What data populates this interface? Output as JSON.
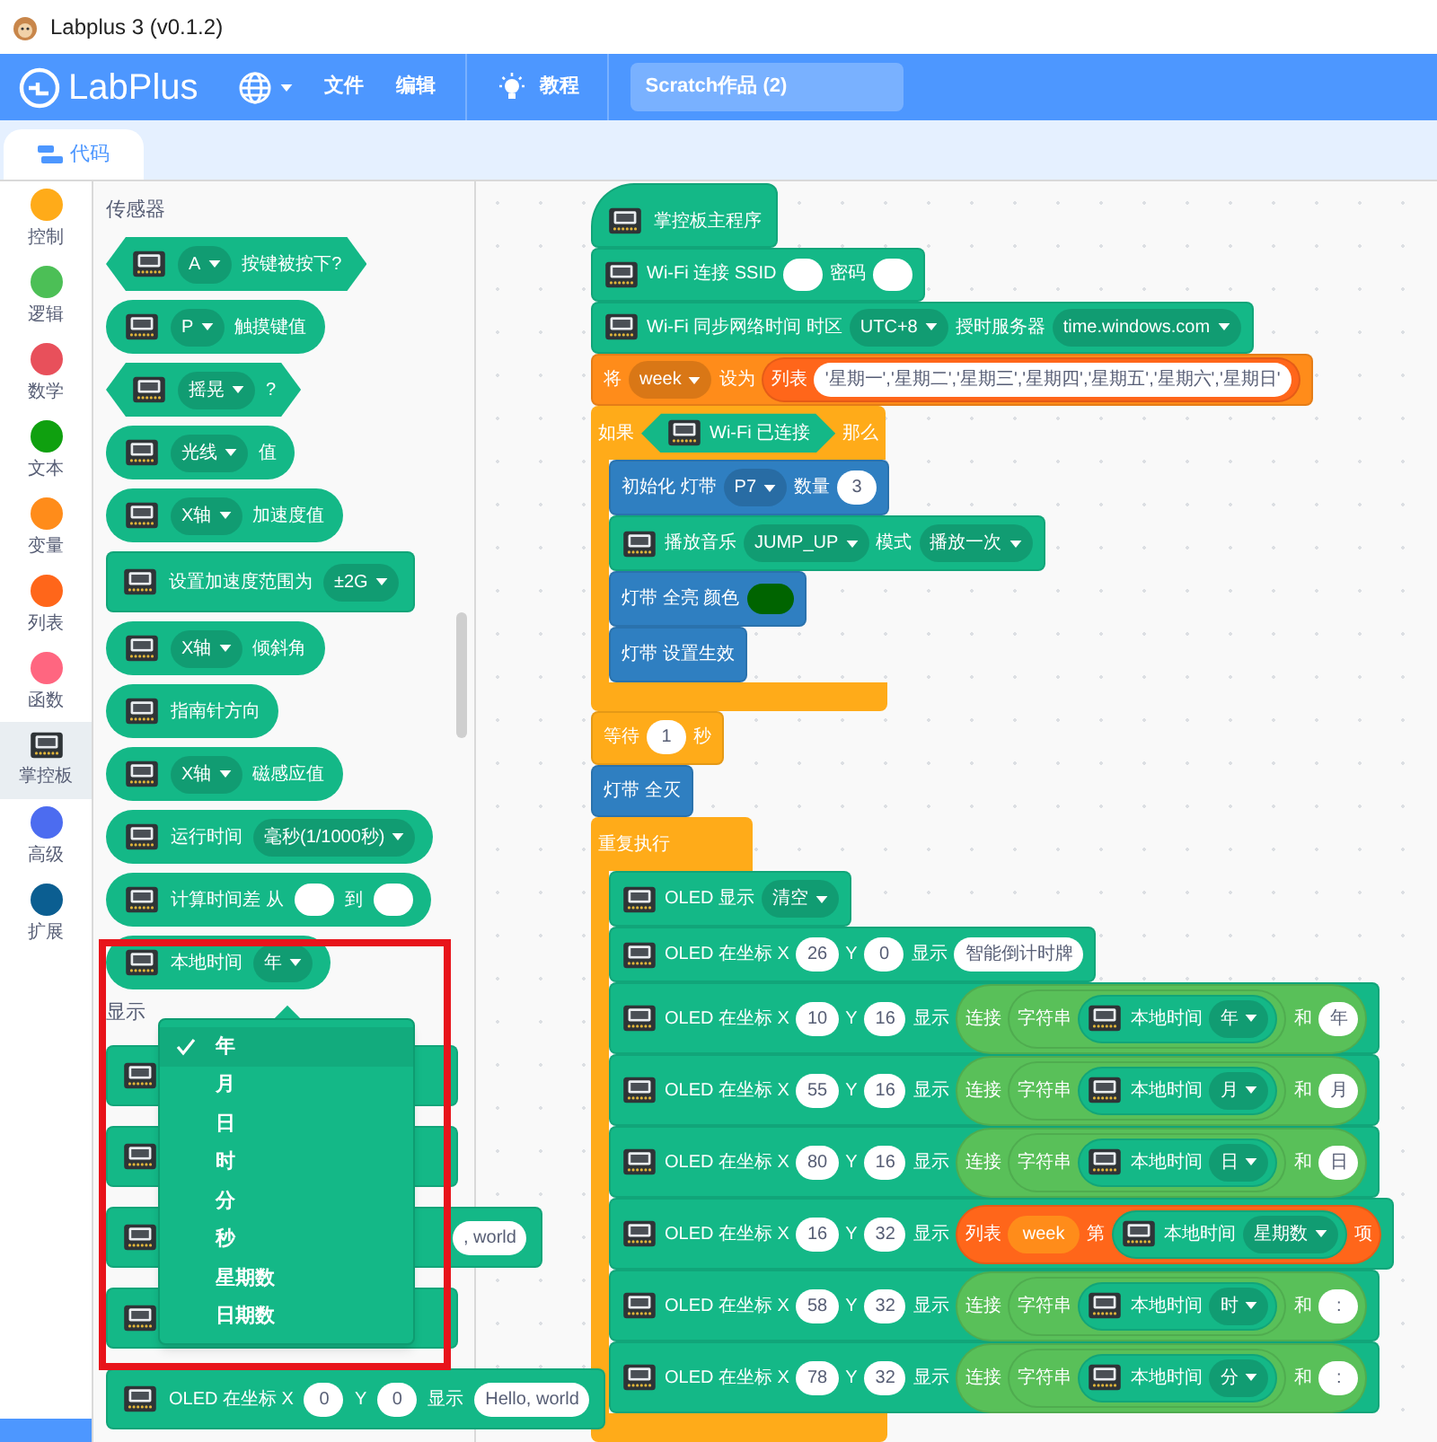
{
  "window": {
    "title": "Labplus 3 (v0.1.2)"
  },
  "header": {
    "logo": "LabPlus",
    "menus": [
      {
        "label": "文件"
      },
      {
        "label": "编辑"
      }
    ],
    "tutorial": "教程",
    "project_title": "Scratch作品 (2)"
  },
  "tabs": [
    {
      "label": "代码",
      "selected": true
    }
  ],
  "categories": [
    {
      "label": "控制",
      "kind": "dot",
      "color": "#ffab19",
      "selected": false
    },
    {
      "label": "逻辑",
      "kind": "dot",
      "color": "#4cbf56",
      "selected": false
    },
    {
      "label": "数学",
      "kind": "dot",
      "color": "#e8505b",
      "selected": false
    },
    {
      "label": "文本",
      "kind": "dot",
      "color": "#0fa00f",
      "selected": false
    },
    {
      "label": "变量",
      "kind": "dot",
      "color": "#ff8c1a",
      "selected": false
    },
    {
      "label": "列表",
      "kind": "dot",
      "color": "#ff661a",
      "selected": false
    },
    {
      "label": "函数",
      "kind": "dot",
      "color": "#ff6680",
      "selected": false
    },
    {
      "label": "掌控板",
      "kind": "board",
      "selected": true
    },
    {
      "label": "高级",
      "kind": "dot",
      "color": "#4c6cf0",
      "selected": false
    },
    {
      "label": "扩展",
      "kind": "dot",
      "color": "#0b5e91",
      "selected": false
    }
  ],
  "palette": [
    {
      "kind": "label",
      "text": "传感器"
    },
    {
      "kind": "hex",
      "color": "#14b887",
      "parts": [
        {
          "kind": "board"
        },
        {
          "kind": "dd",
          "text": "A"
        },
        {
          "kind": "text",
          "text": "按键被按下?"
        }
      ]
    },
    {
      "kind": "round",
      "color": "#14b887",
      "parts": [
        {
          "kind": "board"
        },
        {
          "kind": "dd",
          "text": "P"
        },
        {
          "kind": "text",
          "text": "触摸键值"
        }
      ]
    },
    {
      "kind": "hex",
      "color": "#14b887",
      "parts": [
        {
          "kind": "board"
        },
        {
          "kind": "dd",
          "text": "摇晃"
        },
        {
          "kind": "text",
          "text": "?"
        }
      ]
    },
    {
      "kind": "round",
      "color": "#14b887",
      "parts": [
        {
          "kind": "board"
        },
        {
          "kind": "dd",
          "text": "光线"
        },
        {
          "kind": "text",
          "text": "值"
        }
      ]
    },
    {
      "kind": "round",
      "color": "#14b887",
      "parts": [
        {
          "kind": "board"
        },
        {
          "kind": "dd",
          "text": "X轴"
        },
        {
          "kind": "text",
          "text": "加速度值"
        }
      ]
    },
    {
      "kind": "stack",
      "color": "#14b887",
      "parts": [
        {
          "kind": "board"
        },
        {
          "kind": "text",
          "text": "设置加速度范围为"
        },
        {
          "kind": "dd",
          "text": "±2G"
        }
      ]
    },
    {
      "kind": "round",
      "color": "#14b887",
      "parts": [
        {
          "kind": "board"
        },
        {
          "kind": "dd",
          "text": "X轴"
        },
        {
          "kind": "text",
          "text": "倾斜角"
        }
      ]
    },
    {
      "kind": "round",
      "color": "#14b887",
      "parts": [
        {
          "kind": "board"
        },
        {
          "kind": "text",
          "text": "指南针方向"
        }
      ]
    },
    {
      "kind": "round",
      "color": "#14b887",
      "parts": [
        {
          "kind": "board"
        },
        {
          "kind": "dd",
          "text": "X轴"
        },
        {
          "kind": "text",
          "text": "磁感应值"
        }
      ]
    },
    {
      "kind": "round",
      "color": "#14b887",
      "parts": [
        {
          "kind": "board"
        },
        {
          "kind": "text",
          "text": "运行时间"
        },
        {
          "kind": "dd",
          "text": "毫秒(1/1000秒)"
        }
      ]
    },
    {
      "kind": "round",
      "color": "#14b887",
      "parts": [
        {
          "kind": "board"
        },
        {
          "kind": "text",
          "text": "计算时间差 从"
        },
        {
          "kind": "in"
        },
        {
          "kind": "text",
          "text": "到"
        },
        {
          "kind": "in"
        }
      ]
    },
    {
      "kind": "round",
      "color": "#14b887",
      "parts": [
        {
          "kind": "board"
        },
        {
          "kind": "text",
          "text": "本地时间"
        },
        {
          "kind": "dd",
          "text": "年"
        }
      ]
    },
    {
      "kind": "label",
      "text": "显示"
    },
    {
      "kind": "stack",
      "color": "#14b887",
      "parts": [
        {
          "kind": "board"
        },
        {
          "kind": "covered"
        }
      ]
    },
    {
      "kind": "stack",
      "color": "#14b887",
      "parts": [
        {
          "kind": "board"
        },
        {
          "kind": "covered"
        }
      ]
    },
    {
      "kind": "stack",
      "color": "#14b887",
      "parts": [
        {
          "kind": "board"
        },
        {
          "kind": "covered"
        },
        {
          "kind": "in",
          "text": ", world"
        }
      ]
    },
    {
      "kind": "stack",
      "color": "#14b887",
      "parts": [
        {
          "kind": "board"
        },
        {
          "kind": "covered"
        }
      ]
    },
    {
      "kind": "stack",
      "color": "#14b887",
      "parts": [
        {
          "kind": "board"
        },
        {
          "kind": "text",
          "text": "OLED 在坐标 X"
        },
        {
          "kind": "in",
          "text": "0"
        },
        {
          "kind": "text",
          "text": "Y"
        },
        {
          "kind": "in",
          "text": "0"
        },
        {
          "kind": "text",
          "text": "显示"
        },
        {
          "kind": "in",
          "text": "Hello, world"
        }
      ]
    }
  ],
  "dropdown_menu": [
    {
      "label": "年",
      "selected": true
    },
    {
      "label": "月",
      "selected": false
    },
    {
      "label": "日",
      "selected": false
    },
    {
      "label": "时",
      "selected": false
    },
    {
      "label": "分",
      "selected": false
    },
    {
      "label": "秒",
      "selected": false
    },
    {
      "label": "星期数",
      "selected": false
    },
    {
      "label": "日期数",
      "selected": false
    }
  ],
  "script": [
    {
      "kind": "hat",
      "color": "#14b887",
      "parts": [
        {
          "kind": "board"
        },
        {
          "kind": "text",
          "text": "掌控板主程序"
        }
      ]
    },
    {
      "kind": "stack",
      "color": "#14b887",
      "parts": [
        {
          "kind": "board"
        },
        {
          "kind": "text",
          "text": "Wi-Fi 连接 SSID"
        },
        {
          "kind": "in"
        },
        {
          "kind": "text",
          "text": "密码"
        },
        {
          "kind": "in"
        }
      ]
    },
    {
      "kind": "stack",
      "color": "#14b887",
      "parts": [
        {
          "kind": "board"
        },
        {
          "kind": "text",
          "text": "Wi-Fi 同步网络时间 时区"
        },
        {
          "kind": "dd",
          "text": "UTC+8"
        },
        {
          "kind": "text",
          "text": "授时服务器"
        },
        {
          "kind": "dd",
          "text": "time.windows.com"
        }
      ]
    },
    {
      "kind": "stack",
      "color": "#ff8c1a",
      "parts": [
        {
          "kind": "text",
          "text": "将"
        },
        {
          "kind": "dd",
          "text": "week"
        },
        {
          "kind": "text",
          "text": "设为"
        },
        {
          "kind": "oval",
          "color": "#ff661a",
          "parts": [
            {
              "kind": "text",
              "text": "列表"
            },
            {
              "kind": "in",
              "text": "'星期一','星期二','星期三','星期四','星期五','星期六','星期日'"
            }
          ]
        }
      ]
    },
    {
      "kind": "c",
      "color": "#ffab19",
      "parts": [
        {
          "kind": "text",
          "text": "如果"
        },
        {
          "kind": "hex",
          "color": "#14b887",
          "parts": [
            {
              "kind": "board"
            },
            {
              "kind": "text",
              "text": "Wi-Fi 已连接"
            }
          ]
        },
        {
          "kind": "text",
          "text": "那么"
        }
      ],
      "children": [
        {
          "kind": "stack",
          "color": "#2f7fc1",
          "parts": [
            {
              "kind": "text",
              "text": "初始化 灯带"
            },
            {
              "kind": "dd",
              "text": "P7"
            },
            {
              "kind": "text",
              "text": "数量"
            },
            {
              "kind": "in",
              "text": "3"
            }
          ]
        },
        {
          "kind": "stack",
          "color": "#14b887",
          "parts": [
            {
              "kind": "board"
            },
            {
              "kind": "text",
              "text": "播放音乐"
            },
            {
              "kind": "dd",
              "text": "JUMP_UP"
            },
            {
              "kind": "text",
              "text": "模式"
            },
            {
              "kind": "dd",
              "text": "播放一次"
            }
          ]
        },
        {
          "kind": "stack",
          "color": "#2f7fc1",
          "parts": [
            {
              "kind": "text",
              "text": "灯带 全亮 颜色"
            },
            {
              "kind": "swatch",
              "color": "#006400"
            }
          ]
        },
        {
          "kind": "stack",
          "color": "#2f7fc1",
          "parts": [
            {
              "kind": "text",
              "text": "灯带 设置生效"
            }
          ]
        }
      ]
    },
    {
      "kind": "stack",
      "color": "#ffab19",
      "parts": [
        {
          "kind": "text",
          "text": "等待"
        },
        {
          "kind": "in",
          "text": "1"
        },
        {
          "kind": "text",
          "text": "秒"
        }
      ]
    },
    {
      "kind": "stack",
      "color": "#2f7fc1",
      "parts": [
        {
          "kind": "text",
          "text": "灯带 全灭"
        }
      ]
    },
    {
      "kind": "c",
      "color": "#ffab19",
      "parts": [
        {
          "kind": "text",
          "text": "重复执行"
        }
      ],
      "children": [
        {
          "kind": "stack",
          "color": "#14b887",
          "parts": [
            {
              "kind": "board"
            },
            {
              "kind": "text",
              "text": "OLED 显示"
            },
            {
              "kind": "dd",
              "text": "清空"
            }
          ]
        },
        {
          "kind": "stack",
          "color": "#14b887",
          "parts": [
            {
              "kind": "board"
            },
            {
              "kind": "text",
              "text": "OLED 在坐标 X"
            },
            {
              "kind": "in",
              "text": "26"
            },
            {
              "kind": "text",
              "text": "Y"
            },
            {
              "kind": "in",
              "text": "0"
            },
            {
              "kind": "text",
              "text": "显示"
            },
            {
              "kind": "in",
              "text": "智能倒计时牌"
            }
          ]
        },
        {
          "kind": "stack",
          "color": "#14b887",
          "parts": [
            {
              "kind": "board"
            },
            {
              "kind": "text",
              "text": "OLED 在坐标 X"
            },
            {
              "kind": "in",
              "text": "10"
            },
            {
              "kind": "text",
              "text": "Y"
            },
            {
              "kind": "in",
              "text": "16"
            },
            {
              "kind": "text",
              "text": "显示"
            },
            {
              "kind": "oval",
              "color": "#59c059",
              "parts": [
                {
                  "kind": "text",
                  "text": "连接"
                },
                {
                  "kind": "oval",
                  "color": "#59c059",
                  "parts": [
                    {
                      "kind": "text",
                      "text": "字符串"
                    },
                    {
                      "kind": "oval",
                      "color": "#14b887",
                      "parts": [
                        {
                          "kind": "board"
                        },
                        {
                          "kind": "text",
                          "text": "本地时间"
                        },
                        {
                          "kind": "dd",
                          "text": "年"
                        }
                      ]
                    }
                  ]
                },
                {
                  "kind": "text",
                  "text": "和"
                },
                {
                  "kind": "in",
                  "text": "年"
                }
              ]
            }
          ]
        },
        {
          "kind": "stack",
          "color": "#14b887",
          "parts": [
            {
              "kind": "board"
            },
            {
              "kind": "text",
              "text": "OLED 在坐标 X"
            },
            {
              "kind": "in",
              "text": "55"
            },
            {
              "kind": "text",
              "text": "Y"
            },
            {
              "kind": "in",
              "text": "16"
            },
            {
              "kind": "text",
              "text": "显示"
            },
            {
              "kind": "oval",
              "color": "#59c059",
              "parts": [
                {
                  "kind": "text",
                  "text": "连接"
                },
                {
                  "kind": "oval",
                  "color": "#59c059",
                  "parts": [
                    {
                      "kind": "text",
                      "text": "字符串"
                    },
                    {
                      "kind": "oval",
                      "color": "#14b887",
                      "parts": [
                        {
                          "kind": "board"
                        },
                        {
                          "kind": "text",
                          "text": "本地时间"
                        },
                        {
                          "kind": "dd",
                          "text": "月"
                        }
                      ]
                    }
                  ]
                },
                {
                  "kind": "text",
                  "text": "和"
                },
                {
                  "kind": "in",
                  "text": "月"
                }
              ]
            }
          ]
        },
        {
          "kind": "stack",
          "color": "#14b887",
          "parts": [
            {
              "kind": "board"
            },
            {
              "kind": "text",
              "text": "OLED 在坐标 X"
            },
            {
              "kind": "in",
              "text": "80"
            },
            {
              "kind": "text",
              "text": "Y"
            },
            {
              "kind": "in",
              "text": "16"
            },
            {
              "kind": "text",
              "text": "显示"
            },
            {
              "kind": "oval",
              "color": "#59c059",
              "parts": [
                {
                  "kind": "text",
                  "text": "连接"
                },
                {
                  "kind": "oval",
                  "color": "#59c059",
                  "parts": [
                    {
                      "kind": "text",
                      "text": "字符串"
                    },
                    {
                      "kind": "oval",
                      "color": "#14b887",
                      "parts": [
                        {
                          "kind": "board"
                        },
                        {
                          "kind": "text",
                          "text": "本地时间"
                        },
                        {
                          "kind": "dd",
                          "text": "日"
                        }
                      ]
                    }
                  ]
                },
                {
                  "kind": "text",
                  "text": "和"
                },
                {
                  "kind": "in",
                  "text": "日"
                }
              ]
            }
          ]
        },
        {
          "kind": "stack",
          "color": "#14b887",
          "parts": [
            {
              "kind": "board"
            },
            {
              "kind": "text",
              "text": "OLED 在坐标 X"
            },
            {
              "kind": "in",
              "text": "16"
            },
            {
              "kind": "text",
              "text": "Y"
            },
            {
              "kind": "in",
              "text": "32"
            },
            {
              "kind": "text",
              "text": "显示"
            },
            {
              "kind": "oval",
              "color": "#ff661a",
              "parts": [
                {
                  "kind": "text",
                  "text": "列表"
                },
                {
                  "kind": "var",
                  "color": "#ff8c1a",
                  "text": "week"
                },
                {
                  "kind": "text",
                  "text": "第"
                },
                {
                  "kind": "oval",
                  "color": "#14b887",
                  "parts": [
                    {
                      "kind": "board"
                    },
                    {
                      "kind": "text",
                      "text": "本地时间"
                    },
                    {
                      "kind": "dd",
                      "text": "星期数"
                    }
                  ]
                },
                {
                  "kind": "text",
                  "text": "项"
                }
              ]
            }
          ]
        },
        {
          "kind": "stack",
          "color": "#14b887",
          "parts": [
            {
              "kind": "board"
            },
            {
              "kind": "text",
              "text": "OLED 在坐标 X"
            },
            {
              "kind": "in",
              "text": "58"
            },
            {
              "kind": "text",
              "text": "Y"
            },
            {
              "kind": "in",
              "text": "32"
            },
            {
              "kind": "text",
              "text": "显示"
            },
            {
              "kind": "oval",
              "color": "#59c059",
              "parts": [
                {
                  "kind": "text",
                  "text": "连接"
                },
                {
                  "kind": "oval",
                  "color": "#59c059",
                  "parts": [
                    {
                      "kind": "text",
                      "text": "字符串"
                    },
                    {
                      "kind": "oval",
                      "color": "#14b887",
                      "parts": [
                        {
                          "kind": "board"
                        },
                        {
                          "kind": "text",
                          "text": "本地时间"
                        },
                        {
                          "kind": "dd",
                          "text": "时"
                        }
                      ]
                    }
                  ]
                },
                {
                  "kind": "text",
                  "text": "和"
                },
                {
                  "kind": "in",
                  "text": ":"
                }
              ]
            }
          ]
        },
        {
          "kind": "stack",
          "color": "#14b887",
          "parts": [
            {
              "kind": "board"
            },
            {
              "kind": "text",
              "text": "OLED 在坐标 X"
            },
            {
              "kind": "in",
              "text": "78"
            },
            {
              "kind": "text",
              "text": "Y"
            },
            {
              "kind": "in",
              "text": "32"
            },
            {
              "kind": "text",
              "text": "显示"
            },
            {
              "kind": "oval",
              "color": "#59c059",
              "parts": [
                {
                  "kind": "text",
                  "text": "连接"
                },
                {
                  "kind": "oval",
                  "color": "#59c059",
                  "parts": [
                    {
                      "kind": "text",
                      "text": "字符串"
                    },
                    {
                      "kind": "oval",
                      "color": "#14b887",
                      "parts": [
                        {
                          "kind": "board"
                        },
                        {
                          "kind": "text",
                          "text": "本地时间"
                        },
                        {
                          "kind": "dd",
                          "text": "分"
                        }
                      ]
                    }
                  ]
                },
                {
                  "kind": "text",
                  "text": "和"
                },
                {
                  "kind": "in",
                  "text": ":"
                }
              ]
            }
          ]
        }
      ]
    }
  ]
}
